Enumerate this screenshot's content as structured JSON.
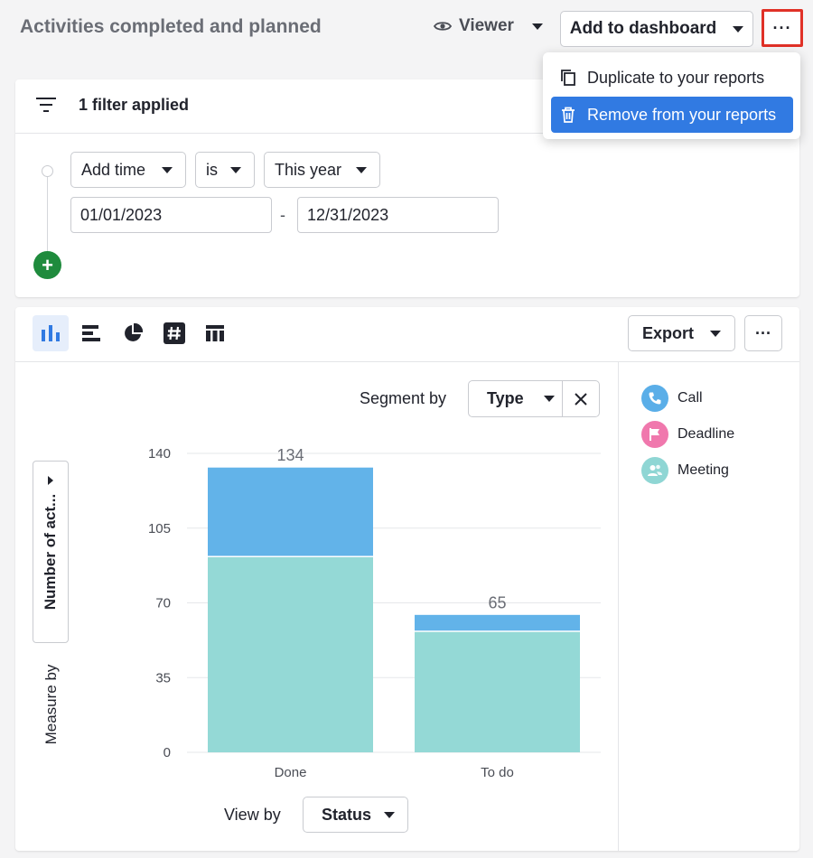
{
  "header": {
    "title": "Activities completed and planned",
    "viewer_label": "Viewer",
    "add_dashboard_label": "Add to dashboard",
    "more_label": "···"
  },
  "menu": {
    "items": [
      {
        "label": "Duplicate to your reports",
        "icon": "copy-icon"
      },
      {
        "label": "Remove from your reports",
        "icon": "trash-icon"
      }
    ]
  },
  "filter": {
    "summary": "1 filter applied",
    "field": "Add time",
    "operator": "is",
    "value": "This year",
    "date_from": "01/01/2023",
    "date_separator": "-",
    "date_to": "12/31/2023"
  },
  "toolbar": {
    "icons": [
      "bar-chart-icon",
      "horizontal-bar-icon",
      "pie-chart-icon",
      "number-icon",
      "table-icon"
    ],
    "export_label": "Export",
    "more_label": "···"
  },
  "segment": {
    "label": "Segment by",
    "value": "Type"
  },
  "measure": {
    "value": "Number of act...",
    "label": "Measure by"
  },
  "view_by": {
    "label": "View by",
    "value": "Status"
  },
  "legend": {
    "items": [
      {
        "name": "Call",
        "color": "#5aaee8",
        "icon": "phone-icon"
      },
      {
        "name": "Deadline",
        "color": "#f078ad",
        "icon": "flag-icon"
      },
      {
        "name": "Meeting",
        "color": "#8fd6d4",
        "icon": "people-icon"
      }
    ]
  },
  "colors": {
    "accent": "#317ae2",
    "add_green": "#1f8b3d",
    "highlight_border": "#e03127"
  },
  "chart_data": {
    "type": "bar",
    "stacked": true,
    "categories": [
      "Done",
      "To do"
    ],
    "series": [
      {
        "name": "Meeting",
        "values": [
          92,
          57
        ],
        "color": "#94d9d6"
      },
      {
        "name": "Deadline",
        "values": [
          0,
          0
        ],
        "color": "#f078ad"
      },
      {
        "name": "Call",
        "values": [
          42,
          8
        ],
        "color": "#62b3e9"
      }
    ],
    "totals": [
      134,
      65
    ],
    "ylim": [
      0,
      140
    ],
    "yticks": [
      0,
      35,
      70,
      105,
      140
    ],
    "grid": true,
    "legend": "right"
  }
}
